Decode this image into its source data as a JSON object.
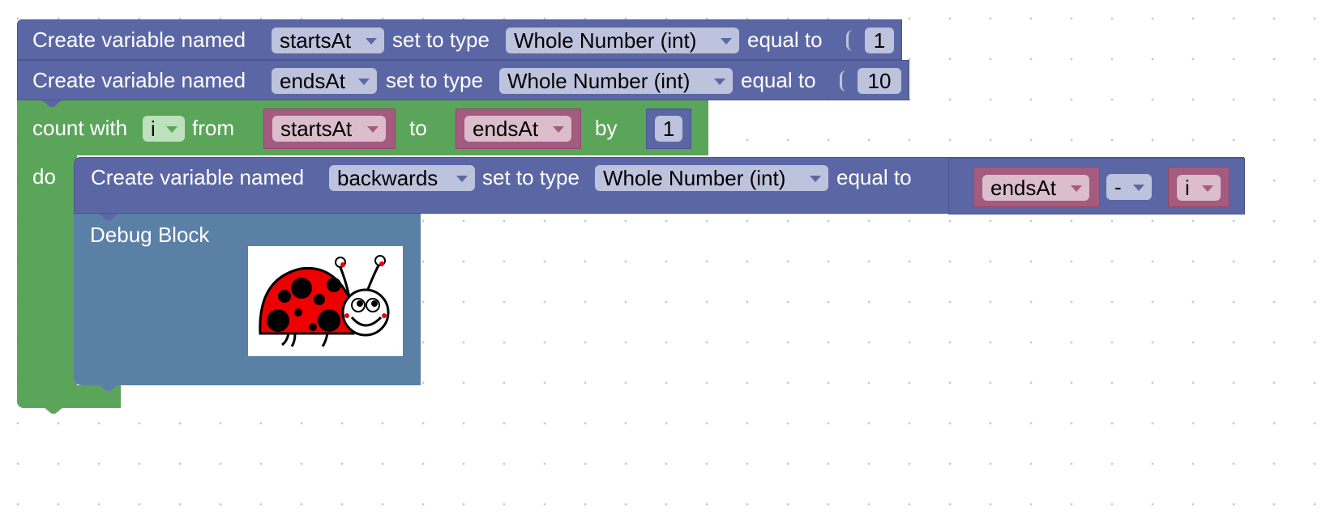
{
  "colors": {
    "variable_block": "#5b67a5",
    "loop_block": "#5ba55b",
    "debug_block": "#5b80a5",
    "variable_getter": "#a55b80",
    "workspace": "#ffffff"
  },
  "block1": {
    "prefix": "Create variable named",
    "var_name": "startsAt",
    "set_label": "set to type",
    "type": "Whole Number (int)",
    "equal_label": "equal to",
    "value": "1"
  },
  "block2": {
    "prefix": "Create variable named",
    "var_name": "endsAt",
    "set_label": "set to type",
    "type": "Whole Number (int)",
    "equal_label": "equal to",
    "value": "10"
  },
  "loop": {
    "count_label": "count with",
    "loop_var": "i",
    "from_label": "from",
    "from_var": "startsAt",
    "to_label": "to",
    "to_var": "endsAt",
    "by_label": "by",
    "by_value": "1",
    "do_label": "do"
  },
  "block3": {
    "prefix": "Create variable named",
    "var_name": "backwards",
    "set_label": "set to type",
    "type": "Whole Number (int)",
    "equal_label": "equal to",
    "left_var": "endsAt",
    "operator": "-",
    "right_var": "i"
  },
  "debug": {
    "title": "Debug Block",
    "image_icon": "ladybug-icon"
  }
}
